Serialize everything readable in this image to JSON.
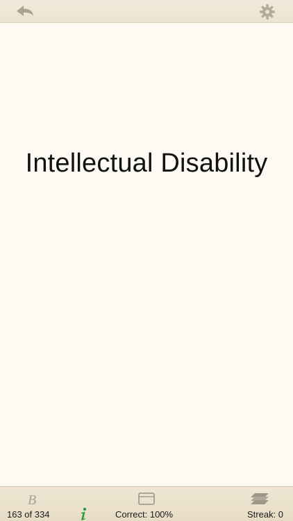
{
  "top_bar": {
    "back_icon": "back-arrow-icon",
    "settings_icon": "gear-icon"
  },
  "card": {
    "term": "Intellectual Disability",
    "background_color": "#fdfaf3"
  },
  "bottom_bar": {
    "bold_icon": "script-b-icon",
    "card_icon": "flashcard-icon",
    "deck_icon": "stack-icon",
    "info_icon": "info-icon",
    "info_color": "#1f9a3a",
    "counter": "163 of 334",
    "correct": "Correct: 100%",
    "streak": "Streak: 0"
  }
}
